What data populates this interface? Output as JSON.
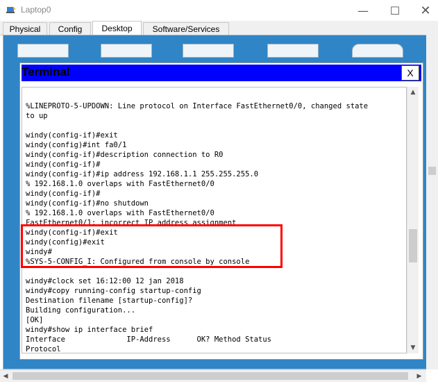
{
  "window": {
    "title": "Laptop0",
    "minimize_glyph": "—",
    "maximize_glyph": "☐",
    "close_glyph": "✕"
  },
  "tabs": [
    {
      "label": "Physical",
      "active": false
    },
    {
      "label": "Config",
      "active": false
    },
    {
      "label": "Desktop",
      "active": true
    },
    {
      "label": "Software/Services",
      "active": false
    }
  ],
  "terminal": {
    "title": "Terminal",
    "close_label": "X",
    "lines": [
      "                                                  ",
      "",
      "%LINEPROTO-5-UPDOWN: Line protocol on Interface FastEthernet0/0, changed state",
      "to up",
      "",
      "windy(config-if)#exit",
      "windy(config)#int fa0/1",
      "windy(config-if)#description connection to R0",
      "windy(config-if)#",
      "windy(config-if)#ip address 192.168.1.1 255.255.255.0",
      "% 192.168.1.0 overlaps with FastEthernet0/0",
      "windy(config-if)#",
      "windy(config-if)#no shutdown",
      "% 192.168.1.0 overlaps with FastEthernet0/0",
      "FastEthernet0/1: incorrect IP address assignment",
      "windy(config-if)#exit",
      "windy(config)#exit",
      "windy#",
      "%SYS-5-CONFIG_I: Configured from console by console",
      "",
      "windy#clock set 16:12:00 12 jan 2018",
      "windy#copy running-config startup-config",
      "Destination filename [startup-config]?",
      "Building configuration...",
      "[OK]",
      "windy#show ip interface brief",
      "Interface              IP-Address      OK? Method Status",
      "Protocol"
    ]
  },
  "colors": {
    "terminal_titlebar": "#0000ff",
    "desktop_bg": "#2f85c6",
    "highlight": "#ff0000"
  },
  "icons": [
    "app-icon",
    "minimize-icon",
    "maximize-icon",
    "close-icon",
    "scroll-up-icon",
    "scroll-down-icon"
  ]
}
